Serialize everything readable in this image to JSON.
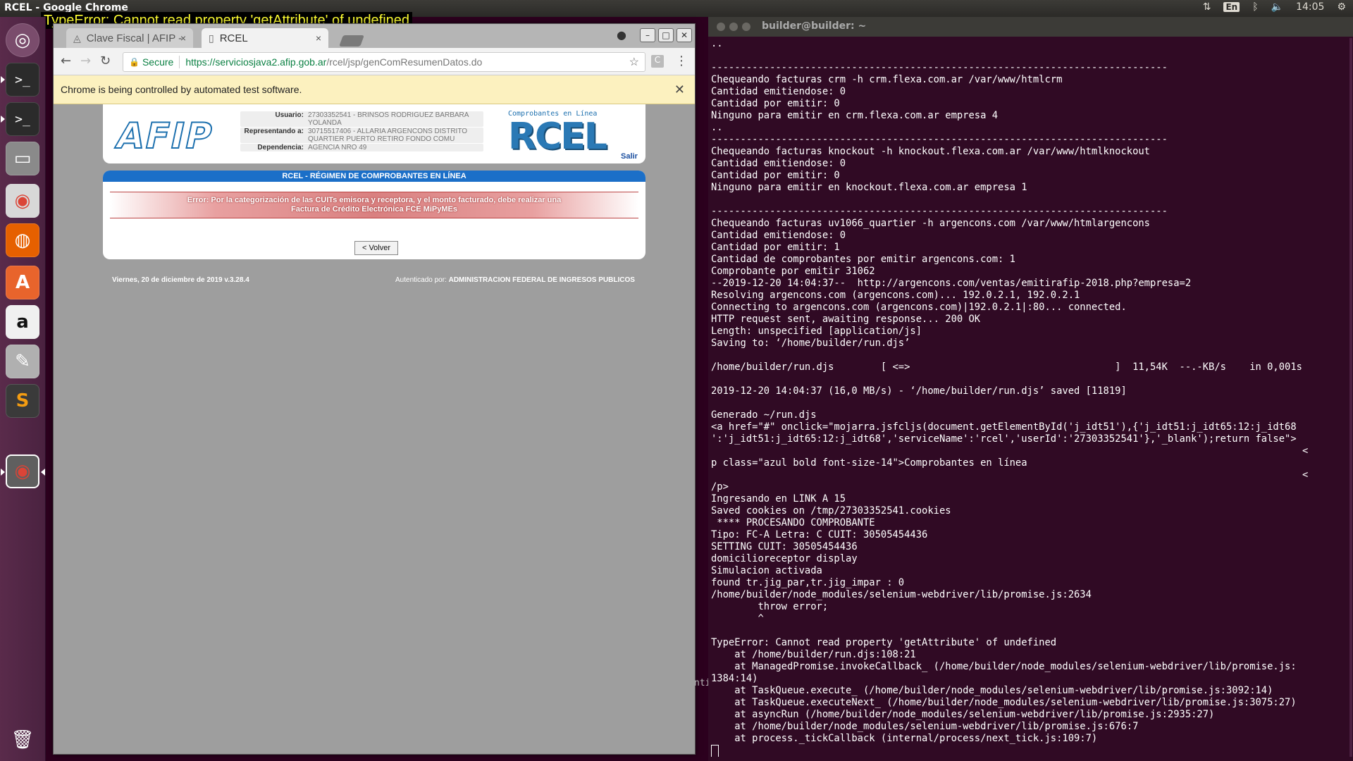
{
  "top_panel": {
    "window_title": "RCEL - Google Chrome",
    "lang": "En",
    "clock": "14:05",
    "icons": [
      "network-icon",
      "keyboard-icon",
      "bluetooth-icon",
      "volume-icon",
      "settings-icon"
    ]
  },
  "error_overlay": "TypeError: Cannot read property 'getAttribute' of undefined",
  "launcher": {
    "items": [
      {
        "name": "ubuntu-dash",
        "glyph": "◎"
      },
      {
        "name": "terminal",
        "glyph": ">_"
      },
      {
        "name": "terminal-2",
        "glyph": ">_"
      },
      {
        "name": "file-manager",
        "glyph": "▭"
      },
      {
        "name": "chrome",
        "glyph": "◉"
      },
      {
        "name": "firefox",
        "glyph": "◍"
      },
      {
        "name": "software-center",
        "glyph": "A"
      },
      {
        "name": "amazon",
        "glyph": "a"
      },
      {
        "name": "system-settings",
        "glyph": "✎"
      },
      {
        "name": "sublime-text",
        "glyph": "S"
      },
      {
        "name": "chrome-active",
        "glyph": "◉"
      },
      {
        "name": "trash",
        "glyph": "🗑"
      }
    ]
  },
  "browser": {
    "tabs": [
      {
        "label": "Clave Fiscal | AFIP -",
        "active": false
      },
      {
        "label": "RCEL",
        "active": true
      }
    ],
    "tab_close_glyph": "×",
    "secure_label": "Secure",
    "url_host": "https://serviciosjava2.afip.gob.ar",
    "url_path": "/rcel/jsp/genComResumenDatos.do",
    "ext_icon_letter": "C",
    "infobar_message": "Chrome is being controlled by automated test software."
  },
  "afip": {
    "logo_text": "AFIP",
    "usuario_label": "Usuario:",
    "usuario_value": "27303352541 - BRINSOS RODRIGUEZ BARBARA YOLANDA",
    "representando_label": "Representando a:",
    "representando_value": "30715517406 - ALLARIA ARGENCONS DISTRITO QUARTIER PUERTO RETIRO FONDO COMU",
    "dependencia_label": "Dependencia:",
    "dependencia_value": "AGENCIA NRO 49",
    "rcel_caption": "Comprobantes en Línea",
    "rcel_logo_text": "RCEL",
    "salir": "Salir",
    "panel_title": "RCEL - RÉGIMEN DE COMPROBANTES EN LÍNEA",
    "error_line1": "Error: Por la categorización de las CUITs emisora y receptora, y el monto facturado, debe realizar una",
    "error_line2": "Factura de Crédito Electrónica FCE MiPyMEs",
    "volver": "< Volver",
    "footer_left": "Viernes, 20 de diciembre de 2019 v.3.28.4",
    "footer_right_prefix": "Autenticado por:",
    "footer_right_org": "ADMINISTRACION FEDERAL DE INGRESOS PUBLICOS"
  },
  "terminal": {
    "title": "builder@builder: ~",
    "stray_text": "ntit",
    "lines": [
      "..",
      "",
      "------------------------------------------------------------------------------",
      "Chequeando facturas crm -h crm.flexa.com.ar /var/www/htmlcrm",
      "Cantidad emitiendose: 0",
      "Cantidad por emitir: 0",
      "Ninguno para emitir en crm.flexa.com.ar empresa 4",
      "..",
      "------------------------------------------------------------------------------",
      "Chequeando facturas knockout -h knockout.flexa.com.ar /var/www/htmlknockout",
      "Cantidad emitiendose: 0",
      "Cantidad por emitir: 0",
      "Ninguno para emitir en knockout.flexa.com.ar empresa 1",
      "",
      "------------------------------------------------------------------------------",
      "Chequeando facturas uv1066_quartier -h argencons.com /var/www/htmlargencons",
      "Cantidad emitiendose: 0",
      "Cantidad por emitir: 1",
      "Cantidad de comprobantes por emitir argencons.com: 1",
      "Comprobante por emitir 31062",
      "--2019-12-20 14:04:37--  http://argencons.com/ventas/emitirafip-2018.php?empresa=2",
      "Resolving argencons.com (argencons.com)... 192.0.2.1, 192.0.2.1",
      "Connecting to argencons.com (argencons.com)|192.0.2.1|:80... connected.",
      "HTTP request sent, awaiting response... 200 OK",
      "Length: unspecified [application/js]",
      "Saving to: ‘/home/builder/run.djs’",
      "",
      "/home/builder/run.djs        [ <=>                                   ]  11,54K  --.-KB/s    in 0,001s",
      "",
      "2019-12-20 14:04:37 (16,0 MB/s) - ‘/home/builder/run.djs’ saved [11819]",
      "",
      "Generado ~/run.djs",
      "<a href=\"#\" onclick=\"mojarra.jsfcljs(document.getElementById('j_idt51'),{'j_idt51:j_idt65:12:j_idt68",
      "':'j_idt51:j_idt65:12:j_idt68','serviceName':'rcel','userId':'27303352541'},'_blank');return false\">",
      "                                                                                                     <",
      "p class=\"azul bold font-size-14\">Comprobantes en línea",
      "                                                                                                     <",
      "/p>",
      "Ingresando en LINK A 15",
      "Saved cookies on /tmp/27303352541.cookies",
      " **** PROCESANDO COMPROBANTE",
      "Tipo: FC-A Letra: C CUIT: 30505454436",
      "SETTING CUIT: 30505454436",
      "domicilioreceptor display",
      "Simulacion activada",
      "found tr.jig_par,tr.jig_impar : 0",
      "/home/builder/node_modules/selenium-webdriver/lib/promise.js:2634",
      "        throw error;",
      "        ^",
      "",
      "TypeError: Cannot read property 'getAttribute' of undefined",
      "    at /home/builder/run.djs:108:21",
      "    at ManagedPromise.invokeCallback_ (/home/builder/node_modules/selenium-webdriver/lib/promise.js:",
      "1384:14)",
      "    at TaskQueue.execute_ (/home/builder/node_modules/selenium-webdriver/lib/promise.js:3092:14)",
      "    at TaskQueue.executeNext_ (/home/builder/node_modules/selenium-webdriver/lib/promise.js:3075:27)",
      "    at asyncRun (/home/builder/node_modules/selenium-webdriver/lib/promise.js:2935:27)",
      "    at /home/builder/node_modules/selenium-webdriver/lib/promise.js:676:7",
      "    at process._tickCallback (internal/process/next_tick.js:109:7)"
    ]
  }
}
